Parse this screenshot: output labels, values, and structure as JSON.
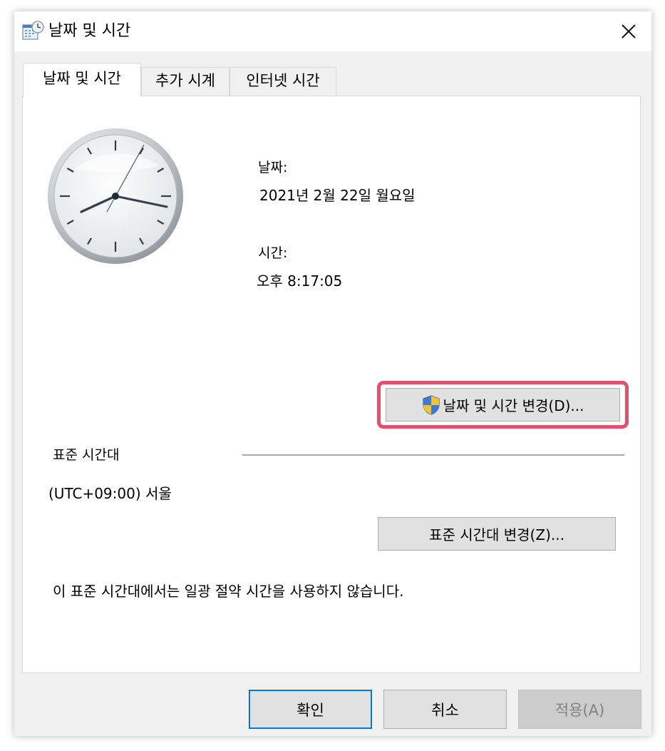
{
  "window": {
    "title": "날짜 및 시간"
  },
  "tabs": [
    {
      "label": "날짜 및 시간",
      "active": true
    },
    {
      "label": "추가 시계",
      "active": false
    },
    {
      "label": "인터넷 시간",
      "active": false
    }
  ],
  "date": {
    "label": "날짜:",
    "value": "2021년 2월 22일 월요일"
  },
  "time": {
    "label": "시간:",
    "value": "오후 8:17:05"
  },
  "change_datetime_button": {
    "label": "날짜 및 시간 변경(D)..."
  },
  "timezone": {
    "section_label": "표준 시간대",
    "value": "(UTC+09:00) 서울",
    "change_button": "표준 시간대 변경(Z)...",
    "dst_note": "이 표준 시간대에서는 일광 절약 시간을 사용하지 않습니다."
  },
  "footer": {
    "ok": "확인",
    "cancel": "취소",
    "apply": "적용(A)"
  },
  "colors": {
    "highlight": "#e0506f",
    "primary_border": "#0078d7"
  },
  "icons": {
    "app": "calendar-clock-icon",
    "close": "close-icon",
    "uac": "uac-shield-icon"
  }
}
